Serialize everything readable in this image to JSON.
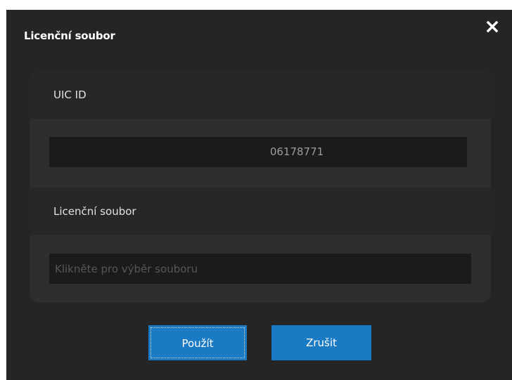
{
  "dialog": {
    "title": "Licenční soubor",
    "close_icon": "close-icon"
  },
  "uic": {
    "label": "UIC ID",
    "value": "06178771"
  },
  "license": {
    "label": "Licenční soubor",
    "placeholder": "Klikněte pro výběr souboru"
  },
  "buttons": {
    "apply": "Použít",
    "cancel": "Zrušit"
  },
  "colors": {
    "accent": "#1a7ac4",
    "background": "#252525"
  }
}
